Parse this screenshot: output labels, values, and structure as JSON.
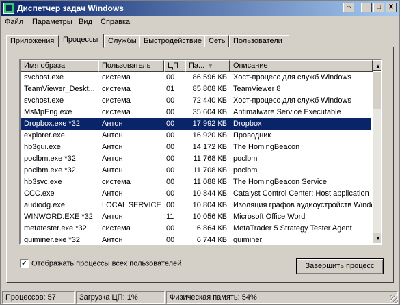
{
  "window": {
    "title": "Диспетчер задач Windows",
    "restore_glyph": "⇔",
    "minimize_glyph": "_",
    "maximize_glyph": "□",
    "close_glyph": "✕"
  },
  "menu": [
    "Файл",
    "Параметры",
    "Вид",
    "Справка"
  ],
  "tabs": [
    "Приложения",
    "Процессы",
    "Службы",
    "Быстродействие",
    "Сеть",
    "Пользователи"
  ],
  "active_tab": "Процессы",
  "columns": [
    "Имя образа",
    "Пользователь",
    "ЦП",
    "Па...",
    "Описание"
  ],
  "sort_indicator": "▼",
  "processes": [
    {
      "name": "svchost.exe",
      "user": "система",
      "cpu": "00",
      "mem": "86 596 КБ",
      "desc": "Хост-процесс для служб Windows"
    },
    {
      "name": "TeamViewer_Deskt...",
      "user": "система",
      "cpu": "01",
      "mem": "85 808 КБ",
      "desc": "TeamViewer 8"
    },
    {
      "name": "svchost.exe",
      "user": "система",
      "cpu": "00",
      "mem": "72 440 КБ",
      "desc": "Хост-процесс для служб Windows"
    },
    {
      "name": "MsMpEng.exe",
      "user": "система",
      "cpu": "00",
      "mem": "35 604 КБ",
      "desc": "Antimalware Service Executable"
    },
    {
      "name": "Dropbox.exe *32",
      "user": "Антон",
      "cpu": "00",
      "mem": "17 992 КБ",
      "desc": "Dropbox"
    },
    {
      "name": "explorer.exe",
      "user": "Антон",
      "cpu": "00",
      "mem": "16 920 КБ",
      "desc": "Проводник"
    },
    {
      "name": "hb3gui.exe",
      "user": "Антон",
      "cpu": "00",
      "mem": "14 172 КБ",
      "desc": "The HomingBeacon"
    },
    {
      "name": "poclbm.exe *32",
      "user": "Антон",
      "cpu": "00",
      "mem": "11 768 КБ",
      "desc": "poclbm"
    },
    {
      "name": "poclbm.exe *32",
      "user": "Антон",
      "cpu": "00",
      "mem": "11 708 КБ",
      "desc": "poclbm"
    },
    {
      "name": "hb3svc.exe",
      "user": "система",
      "cpu": "00",
      "mem": "11 088 КБ",
      "desc": "The HomingBeacon Service"
    },
    {
      "name": "CCC.exe",
      "user": "Антон",
      "cpu": "00",
      "mem": "10 844 КБ",
      "desc": "Catalyst Control Center: Host application"
    },
    {
      "name": "audiodg.exe",
      "user": "LOCAL SERVICE",
      "cpu": "00",
      "mem": "10 804 КБ",
      "desc": "Изоляция графов аудиоустройств Windows"
    },
    {
      "name": "WINWORD.EXE *32",
      "user": "Антон",
      "cpu": "11",
      "mem": "10 056 КБ",
      "desc": "Microsoft Office Word"
    },
    {
      "name": "metatester.exe *32",
      "user": "система",
      "cpu": "00",
      "mem": "6 864 КБ",
      "desc": "MetaTrader 5 Strategy Tester Agent"
    },
    {
      "name": "guiminer.exe *32",
      "user": "Антон",
      "cpu": "00",
      "mem": "6 744 КБ",
      "desc": "guiminer"
    }
  ],
  "selected_index": 4,
  "scroll_up_glyph": "▲",
  "scroll_down_glyph": "▼",
  "show_all_label": "Отображать процессы всех пользователей",
  "show_all_checked_glyph": "✓",
  "end_process_label": "Завершить процесс",
  "status": {
    "processes": "Процессов: 57",
    "cpu": "Загрузка ЦП: 1%",
    "memory": "Физическая память: 54%"
  }
}
